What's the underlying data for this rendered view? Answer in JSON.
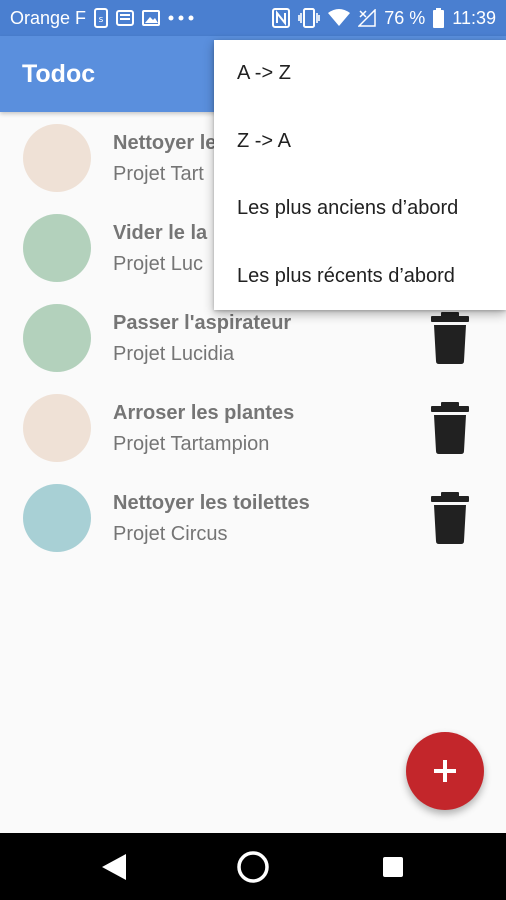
{
  "status_bar": {
    "carrier": "Orange F",
    "battery": "76 %",
    "time": "11:39",
    "icons": [
      "data-saver-icon",
      "news-icon",
      "image-icon",
      "more-icon",
      "nfc-icon",
      "vibrate-icon",
      "wifi-icon",
      "no-signal-icon",
      "battery-icon"
    ]
  },
  "app_bar": {
    "title": "Todoc"
  },
  "tasks": [
    {
      "name": "Nettoyer le",
      "project": "Projet Tart",
      "color": "#efe1d6"
    },
    {
      "name": "Vider le la",
      "project": "Projet Luc",
      "color": "#b3d1bc"
    },
    {
      "name": "Passer l'aspirateur",
      "project": "Projet Lucidia",
      "color": "#b3d1bc"
    },
    {
      "name": "Arroser les plantes",
      "project": "Projet Tartampion",
      "color": "#efe1d6"
    },
    {
      "name": "Nettoyer les toilettes",
      "project": "Projet Circus",
      "color": "#a8d0d5"
    }
  ],
  "sort_menu": {
    "items": [
      {
        "label": "A -> Z"
      },
      {
        "label": "Z -> A"
      },
      {
        "label": "Les plus anciens d’abord"
      },
      {
        "label": "Les plus récents d’abord"
      }
    ]
  },
  "fab": {
    "icon": "plus-icon",
    "label": "+"
  },
  "nav_bar": {
    "icons": [
      "back-icon",
      "home-icon",
      "recents-icon"
    ]
  },
  "colors": {
    "status_bar": "#4a7fd0",
    "app_bar": "#5a8fdd",
    "fab": "#c3262b",
    "text_secondary": "#757575"
  }
}
